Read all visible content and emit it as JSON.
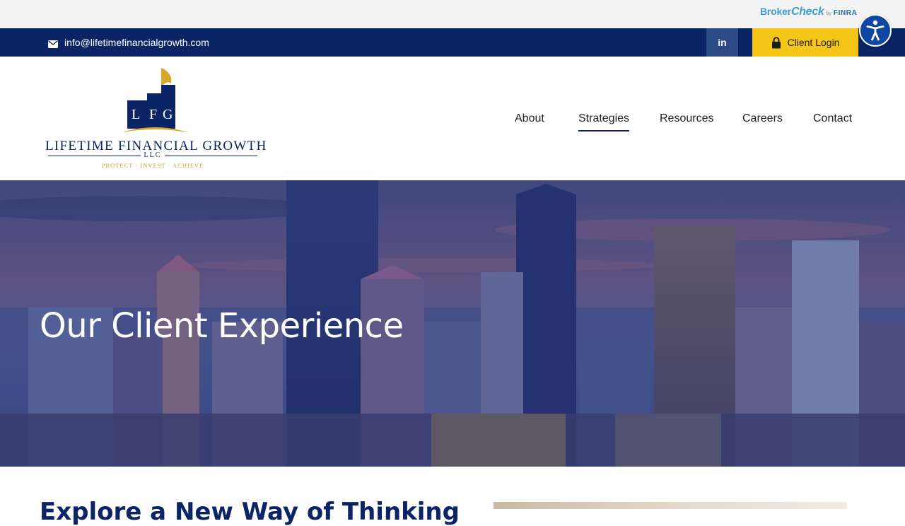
{
  "broker_check": {
    "brand_part1": "Broker",
    "brand_part2": "Check",
    "by": "by",
    "finra": "FINRA"
  },
  "top_bar": {
    "email": "info@lifetimefinancialgrowth.com",
    "linkedin_label": "in",
    "client_login": "Client Login"
  },
  "logo": {
    "monogram": [
      "L",
      "F",
      "G"
    ],
    "wordmark": "LIFETIME FINANCIAL GROWTH",
    "suffix": "LLC",
    "tagline": "PROTECT · INVEST · ACHIEVE"
  },
  "nav": {
    "items": [
      {
        "label": "About",
        "active": false
      },
      {
        "label": "Strategies",
        "active": true
      },
      {
        "label": "Resources",
        "active": false
      },
      {
        "label": "Careers",
        "active": false
      },
      {
        "label": "Contact",
        "active": false
      }
    ]
  },
  "hero": {
    "title": "Our Client Experience"
  },
  "content": {
    "heading": "Explore a New Way of Thinking"
  },
  "colors": {
    "navy": "#0b2466",
    "gold": "#f5c518",
    "accessibility_blue": "#0d47a1"
  },
  "icons": {
    "email": "envelope-icon",
    "login": "lock-icon",
    "accessibility": "accessibility-icon"
  }
}
